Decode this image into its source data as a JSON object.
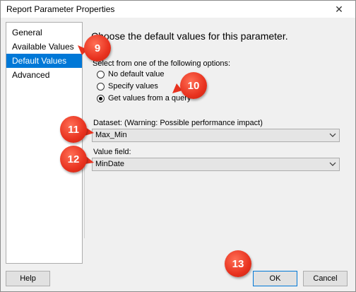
{
  "window": {
    "title": "Report Parameter Properties",
    "close_glyph": "✕"
  },
  "sidebar": {
    "items": [
      {
        "label": "General",
        "selected": false
      },
      {
        "label": "Available Values",
        "selected": false
      },
      {
        "label": "Default Values",
        "selected": true
      },
      {
        "label": "Advanced",
        "selected": false
      }
    ]
  },
  "main": {
    "heading": "Choose the default values for this parameter.",
    "options_label": "Select from one of the following options:",
    "options": [
      {
        "label": "No default value",
        "checked": false
      },
      {
        "label": "Specify values",
        "checked": false
      },
      {
        "label": "Get values from a query",
        "checked": true
      }
    ],
    "dataset": {
      "label": "Dataset: (Warning: Possible performance impact)",
      "value": "Max_Min"
    },
    "value_field": {
      "label": "Value field:",
      "value": "MinDate"
    }
  },
  "footer": {
    "help_label": "Help",
    "ok_label": "OK",
    "cancel_label": "Cancel"
  },
  "annotations": [
    "9",
    "10",
    "11",
    "12",
    "13"
  ],
  "colors": {
    "accent": "#0078d7",
    "badge": "#e8321f"
  }
}
